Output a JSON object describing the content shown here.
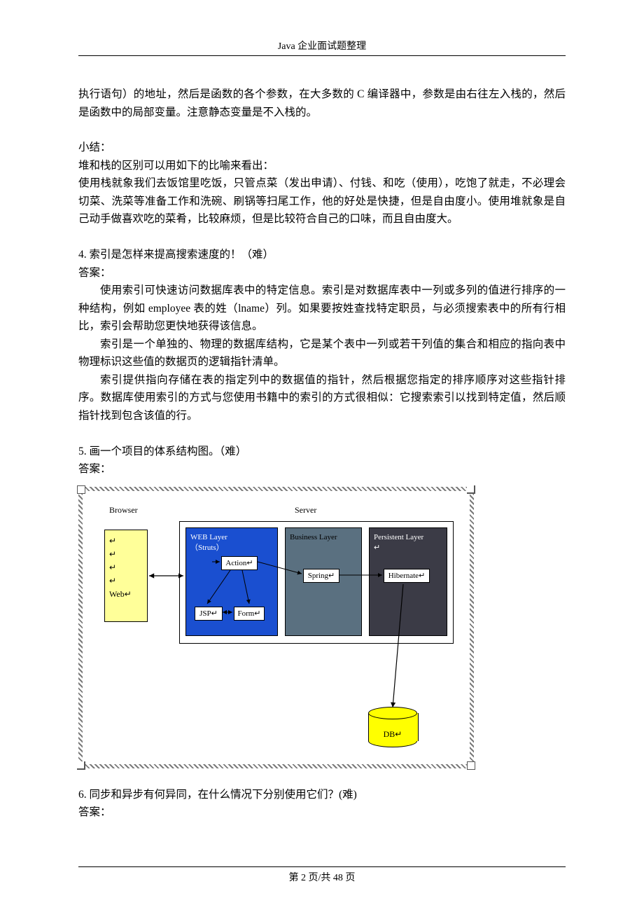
{
  "header": {
    "title": "Java 企业面试题整理"
  },
  "footer": {
    "page_label": "第 2 页/共 48 页"
  },
  "text": {
    "p1": "执行语句）的地址，然后是函数的各个参数，在大多数的 C 编译器中，参数是由右往左入栈的，然后是函数中的局部变量。注意静态变量是不入栈的。",
    "p2a": "小结：",
    "p2b": "堆和栈的区别可以用如下的比喻来看出：",
    "p2c": "使用栈就象我们去饭馆里吃饭，只管点菜（发出申请）、付钱、和吃（使用），吃饱了就走，不必理会切菜、洗菜等准备工作和洗碗、刷锅等扫尾工作，他的好处是快捷，但是自由度小。使用堆就象是自己动手做喜欢吃的菜肴，比较麻烦，但是比较符合自己的口味，而且自由度大。",
    "q4_title": "4.    索引是怎样来提高搜索速度的！（难）",
    "q4_ans_label": "答案：",
    "q4_p1": "使用索引可快速访问数据库表中的特定信息。索引是对数据库表中一列或多列的值进行排序的一种结构，例如 employee 表的姓（lname）列。如果要按姓查找特定职员，与必须搜索表中的所有行相比，索引会帮助您更快地获得该信息。",
    "q4_p2": "索引是一个单独的、物理的数据库结构，它是某个表中一列或若干列值的集合和相应的指向表中物理标识这些值的数据页的逻辑指针清单。",
    "q4_p3": "索引提供指向存储在表的指定列中的数据值的指针，然后根据您指定的排序顺序对这些指针排序。数据库使用索引的方式与您使用书籍中的索引的方式很相似：它搜索索引以找到特定值，然后顺指针找到包含该值的行。",
    "q5_title": "5.    画一个项目的体系结构图。（难）",
    "q5_ans_label": "答案：",
    "q6_title": "6.    同步和异步有何异同，在什么情况下分别使用它们？(难)",
    "q6_ans_label": "答案："
  },
  "diagram": {
    "browser_label": "Browser",
    "server_label": "Server",
    "browser_box_lines": [
      "↵",
      "↵",
      "↵",
      "↵",
      "Web↵"
    ],
    "web_layer_title1": "WEB Layer",
    "web_layer_title2": "（Struts）",
    "action_box": "Action↵",
    "jsp_box": "JSP↵",
    "form_box": "Form↵",
    "biz_layer_title": "Business Layer",
    "spring_box": "Spring↵",
    "per_layer_title": "Persistent Layer",
    "per_layer_sub": "↵",
    "hibernate_box": "Hibernate↵",
    "db_label": "DB↵"
  },
  "chart_data": {
    "type": "diagram",
    "title": "项目体系结构图",
    "nodes": [
      {
        "id": "browser",
        "label": "Browser",
        "contains": [
          "Web"
        ]
      },
      {
        "id": "server",
        "label": "Server",
        "contains": [
          "web_layer",
          "business_layer",
          "persistent_layer"
        ]
      },
      {
        "id": "web_layer",
        "label": "WEB Layer（Struts）",
        "contains": [
          "Action",
          "JSP",
          "Form"
        ]
      },
      {
        "id": "business_layer",
        "label": "Business Layer",
        "contains": [
          "Spring"
        ]
      },
      {
        "id": "persistent_layer",
        "label": "Persistent Layer",
        "contains": [
          "Hibernate"
        ]
      },
      {
        "id": "db",
        "label": "DB"
      }
    ],
    "edges": [
      {
        "from": "browser",
        "to": "web_layer",
        "dir": "both"
      },
      {
        "from": "Action",
        "to": "JSP",
        "dir": "forward"
      },
      {
        "from": "Action",
        "to": "Form",
        "dir": "forward"
      },
      {
        "from": "JSP",
        "to": "Form",
        "dir": "both"
      },
      {
        "from": "Action",
        "to": "Spring",
        "dir": "forward"
      },
      {
        "from": "Spring",
        "to": "Hibernate",
        "dir": "forward"
      },
      {
        "from": "Hibernate",
        "to": "DB",
        "dir": "forward"
      }
    ]
  }
}
